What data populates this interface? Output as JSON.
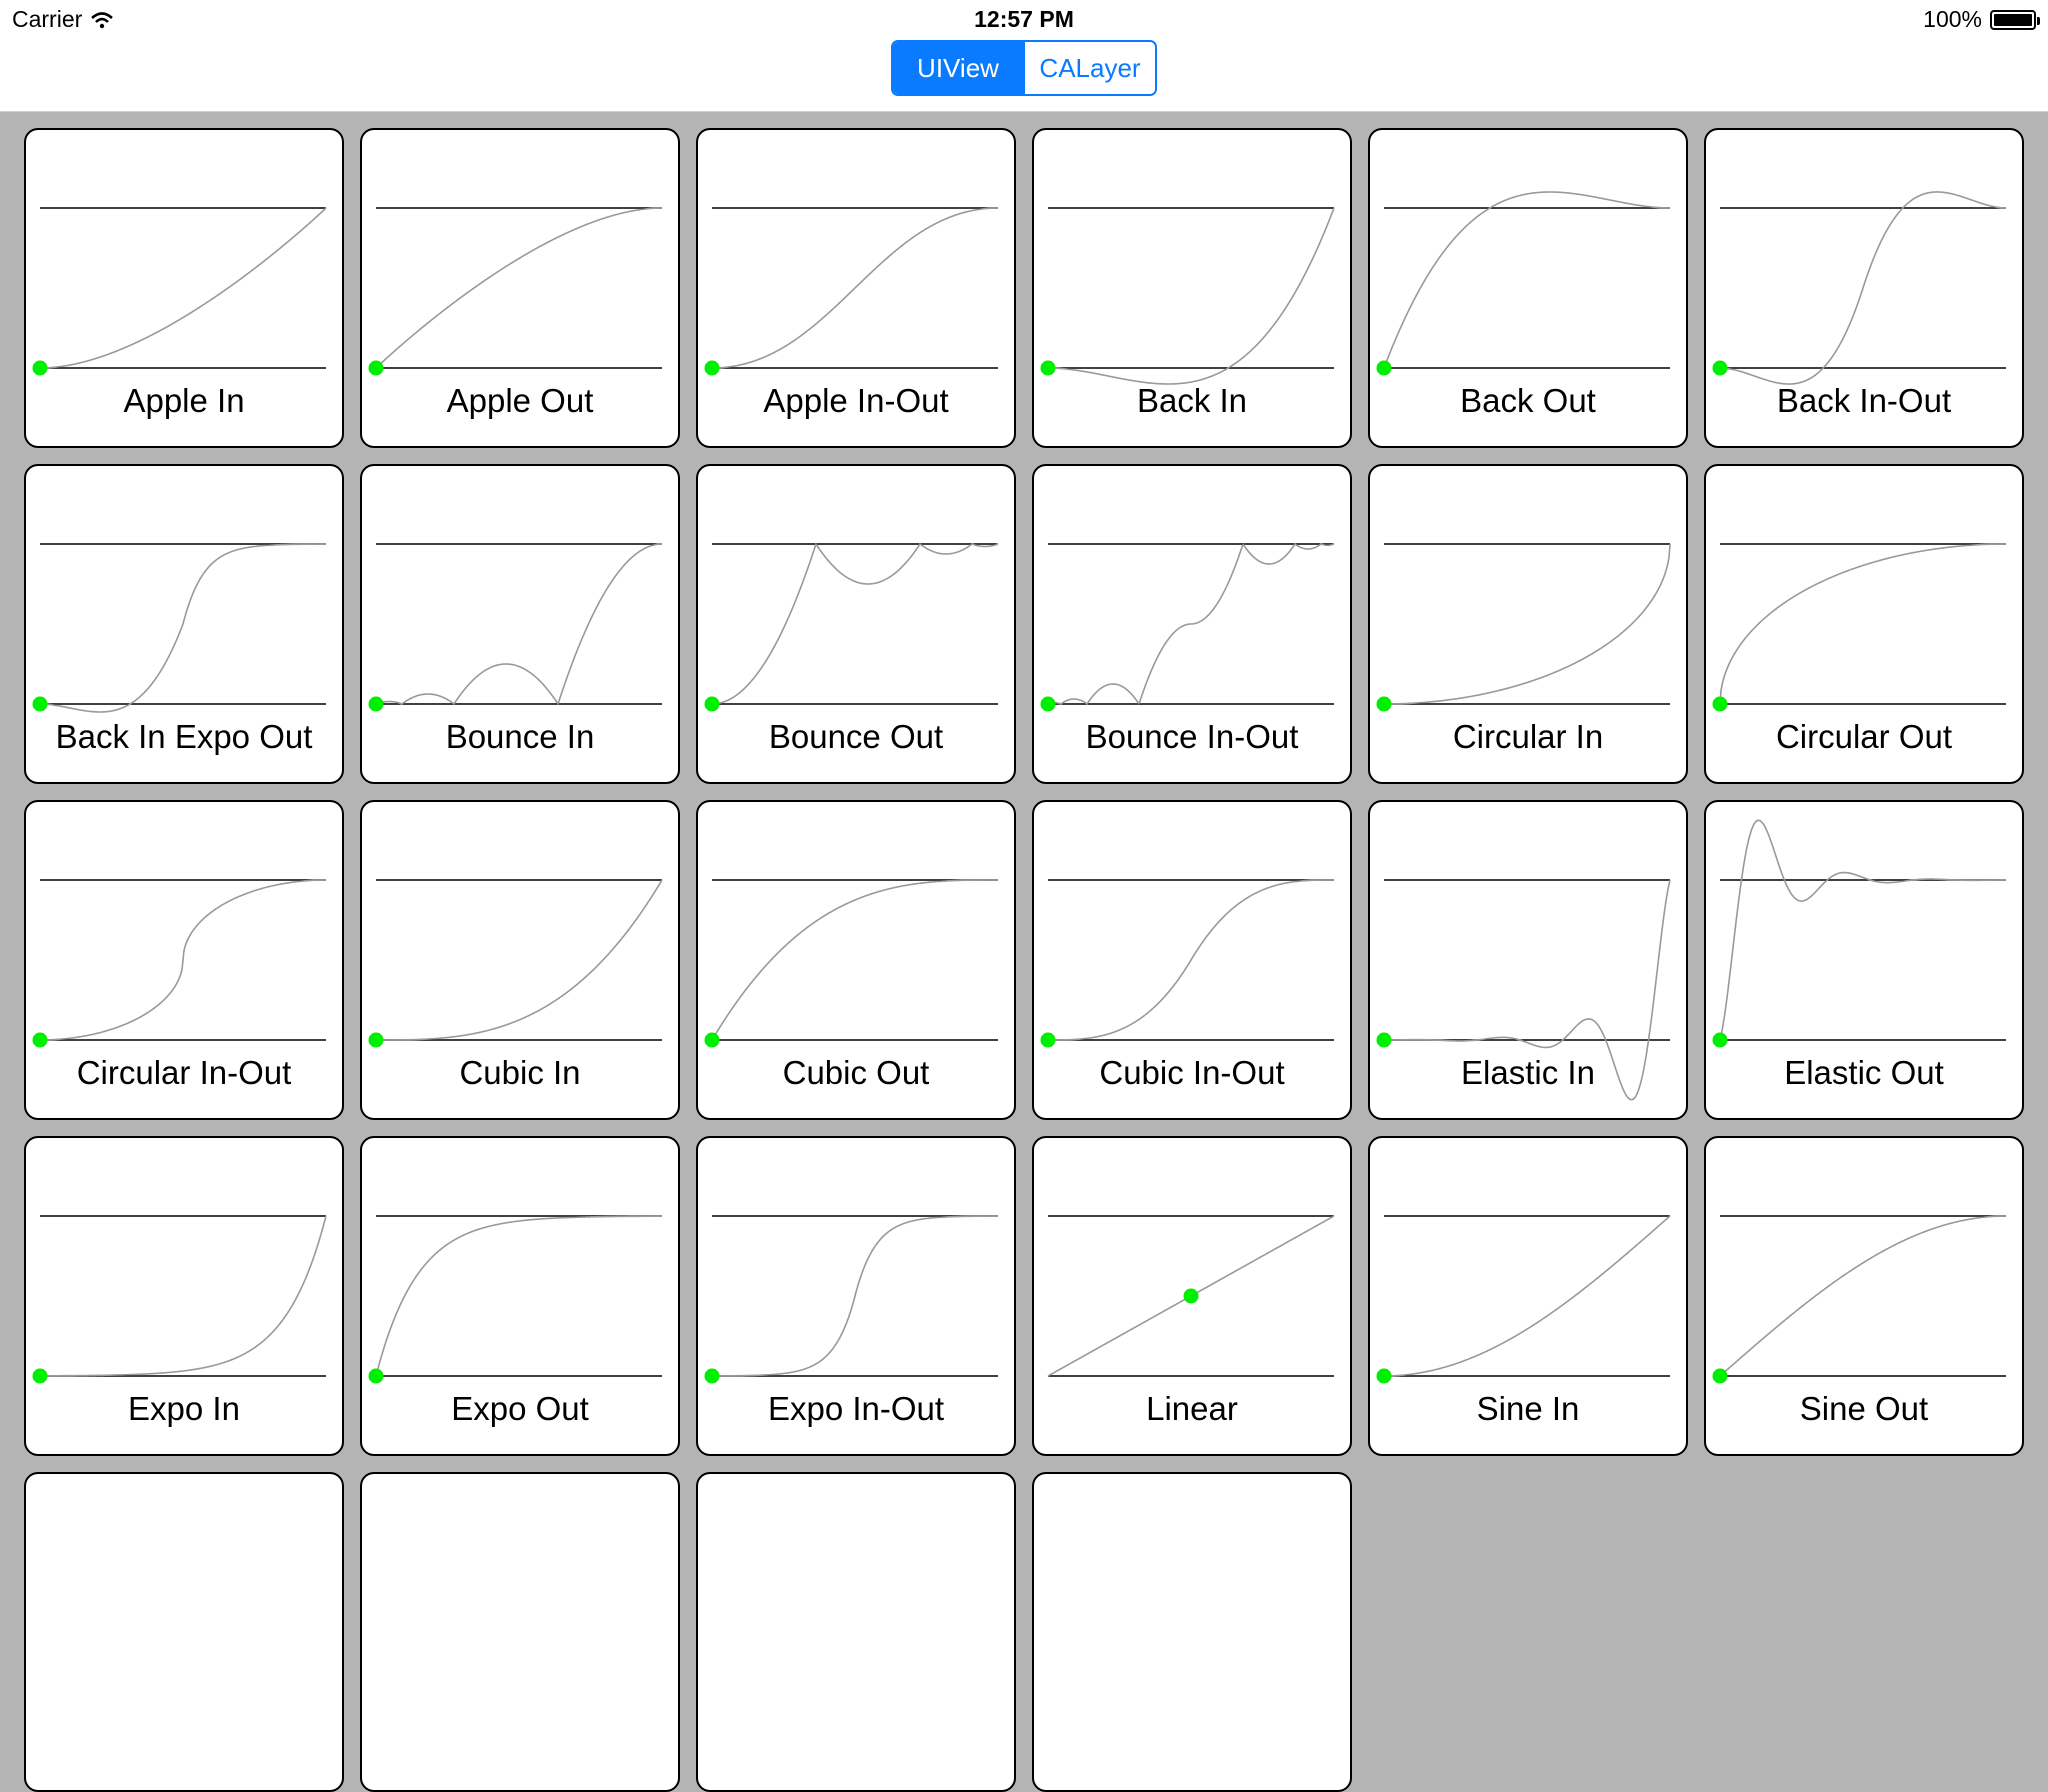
{
  "status_bar": {
    "carrier": "Carrier",
    "time": "12:57 PM",
    "battery": "100%"
  },
  "segmented_control": {
    "options": [
      "UIView",
      "CALayer"
    ],
    "selected": "UIView"
  },
  "colors": {
    "accent": "#0a7bff",
    "dot": "#00ee00",
    "curve": "#999999"
  },
  "easings": [
    {
      "label": "Apple In",
      "fn": "appleIn",
      "dot": 0
    },
    {
      "label": "Apple Out",
      "fn": "appleOut",
      "dot": 0
    },
    {
      "label": "Apple In-Out",
      "fn": "appleInOut",
      "dot": 0
    },
    {
      "label": "Back In",
      "fn": "backIn",
      "dot": 0
    },
    {
      "label": "Back Out",
      "fn": "backOut",
      "dot": 0
    },
    {
      "label": "Back In-Out",
      "fn": "backInOut",
      "dot": 0
    },
    {
      "label": "Back In Expo Out",
      "fn": "backInExpoOut",
      "dot": 0
    },
    {
      "label": "Bounce In",
      "fn": "bounceIn",
      "dot": 0
    },
    {
      "label": "Bounce Out",
      "fn": "bounceOut",
      "dot": 0
    },
    {
      "label": "Bounce In-Out",
      "fn": "bounceInOut",
      "dot": 0
    },
    {
      "label": "Circular In",
      "fn": "circIn",
      "dot": 0
    },
    {
      "label": "Circular Out",
      "fn": "circOut",
      "dot": 0
    },
    {
      "label": "Circular In-Out",
      "fn": "circInOut",
      "dot": 0
    },
    {
      "label": "Cubic In",
      "fn": "cubicIn",
      "dot": 0
    },
    {
      "label": "Cubic Out",
      "fn": "cubicOut",
      "dot": 0
    },
    {
      "label": "Cubic In-Out",
      "fn": "cubicInOut",
      "dot": 0
    },
    {
      "label": "Elastic In",
      "fn": "elasticIn",
      "dot": 0
    },
    {
      "label": "Elastic Out",
      "fn": "elasticOut",
      "dot": 0
    },
    {
      "label": "Expo In",
      "fn": "expoIn",
      "dot": 0
    },
    {
      "label": "Expo Out",
      "fn": "expoOut",
      "dot": 0
    },
    {
      "label": "Expo In-Out",
      "fn": "expoInOut",
      "dot": 0
    },
    {
      "label": "Linear",
      "fn": "linear",
      "dot": 0.5
    },
    {
      "label": "Sine In",
      "fn": "sineIn",
      "dot": 0
    },
    {
      "label": "Sine Out",
      "fn": "sineOut",
      "dot": 0
    },
    {
      "label": "",
      "fn": "",
      "dot": 0
    },
    {
      "label": "",
      "fn": "",
      "dot": 0
    },
    {
      "label": "",
      "fn": "",
      "dot": 0
    },
    {
      "label": "",
      "fn": "",
      "dot": 0
    }
  ]
}
